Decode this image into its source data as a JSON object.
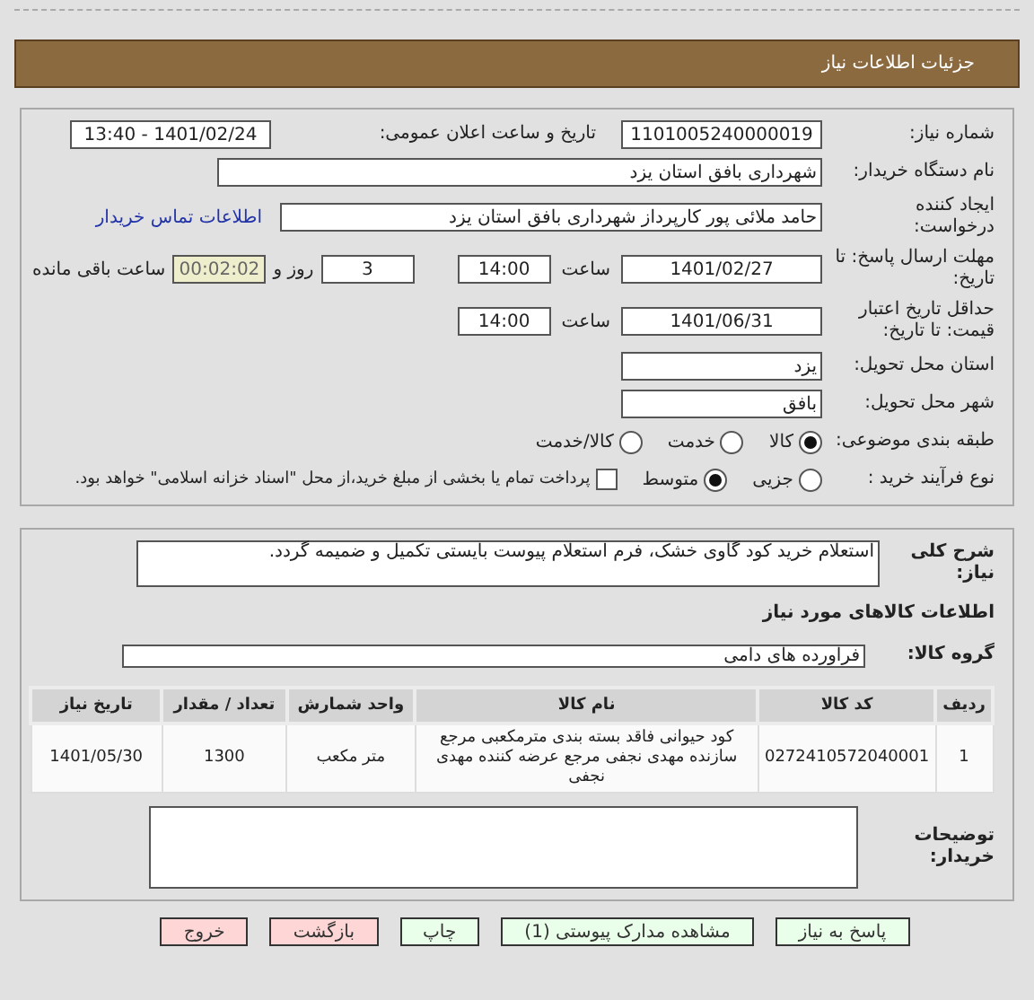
{
  "header": {
    "title": "جزئیات اطلاعات نیاز"
  },
  "need_number": {
    "label": "شماره نیاز:",
    "value": "1101005240000019"
  },
  "announce": {
    "label": "تاریخ و ساعت اعلان عمومی:",
    "value": "1401/02/24 - 13:40"
  },
  "buyer": {
    "label": "نام دستگاه خریدار:",
    "value": "شهرداری بافق استان یزد"
  },
  "creator": {
    "label": "ایجاد کننده درخواست:",
    "value": "حامد ملائی پور کارپرداز شهرداری بافق استان یزد",
    "link": "اطلاعات تماس خریدار"
  },
  "deadline": {
    "label": "مهلت ارسال پاسخ: تا تاریخ:",
    "date": "1401/02/27",
    "time_label": "ساعت",
    "time": "14:00",
    "days": "3",
    "days_label": "روز و",
    "remaining": "00:02:02",
    "remaining_label": "ساعت باقی مانده"
  },
  "validity": {
    "label": "حداقل تاریخ اعتبار قیمت: تا تاریخ:",
    "date": "1401/06/31",
    "time_label": "ساعت",
    "time": "14:00"
  },
  "province": {
    "label": "استان محل تحویل:",
    "value": "یزد"
  },
  "city": {
    "label": "شهر محل تحویل:",
    "value": "بافق"
  },
  "category": {
    "label": "طبقه بندی موضوعی:",
    "options": [
      {
        "label": "كالا",
        "selected": true
      },
      {
        "label": "خدمت",
        "selected": false
      },
      {
        "label": "كالا/خدمت",
        "selected": false
      }
    ]
  },
  "process": {
    "label": "نوع فرآیند خرید :",
    "options": [
      {
        "label": "جزیی",
        "selected": false
      },
      {
        "label": "متوسط",
        "selected": true
      }
    ],
    "treasury": {
      "checked": false,
      "text": "پرداخت تمام یا بخشی از مبلغ خرید،از محل \"اسناد خزانه اسلامی\" خواهد بود."
    }
  },
  "description": {
    "label": "شرح کلی نیاز:",
    "value": "استعلام خرید کود گاوی خشک، فرم استعلام پیوست بایستی تکمیل و ضمیمه گردد."
  },
  "goods_title": "اطلاعات کالاهای مورد نیاز",
  "goods_group": {
    "label": "گروه کالا:",
    "value": "فراورده های دامی"
  },
  "table": {
    "columns": [
      "ردیف",
      "کد کالا",
      "نام کالا",
      "واحد شمارش",
      "تعداد / مقدار",
      "تاریخ نیاز"
    ],
    "rows": [
      [
        "1",
        "0272410572040001",
        "کود حیوانی فاقد بسته بندی مترمکعبی مرجع سازنده مهدی نجفی مرجع عرضه کننده مهدی نجفی",
        "متر مکعب",
        "1300",
        "1401/05/30"
      ]
    ]
  },
  "buyer_notes": {
    "label": "توضیحات خریدار:"
  },
  "buttons": [
    {
      "label": "پاسخ به نیاز",
      "kind": "action"
    },
    {
      "label": "مشاهده مدارک پیوستی (1)",
      "kind": "action"
    },
    {
      "label": "چاپ",
      "kind": "action"
    },
    {
      "label": "بازگشت",
      "kind": "exit"
    },
    {
      "label": "خروج",
      "kind": "exit"
    }
  ]
}
